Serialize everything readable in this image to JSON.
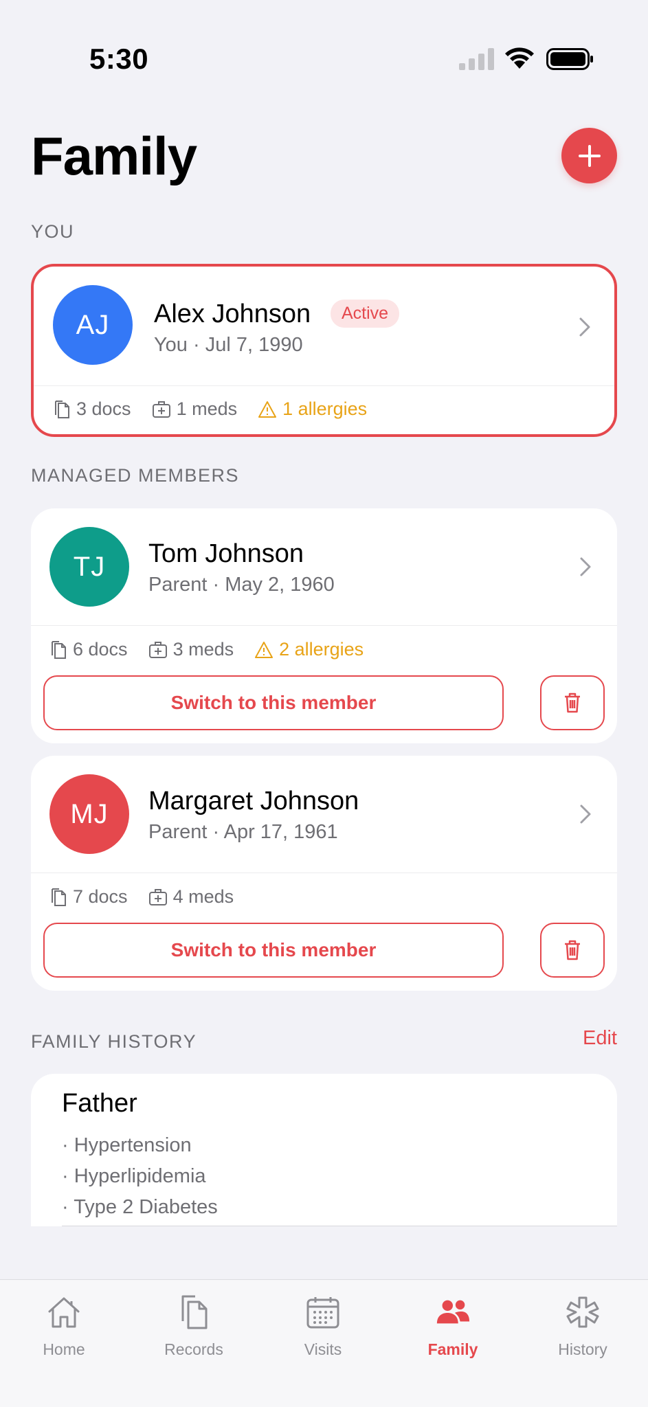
{
  "status_bar": {
    "time": "5:30"
  },
  "header": {
    "title": "Family"
  },
  "sections": {
    "you": "YOU",
    "managed": "MANAGED MEMBERS",
    "history": "FAMILY HISTORY",
    "edit": "Edit"
  },
  "self": {
    "initials": "AJ",
    "name": "Alex Johnson",
    "badge": "Active",
    "subtitle": "You · Jul 7, 1990",
    "docs": "3 docs",
    "meds": "1 meds",
    "allergies": "1 allergies",
    "avatar_color": "#3478F6"
  },
  "members": [
    {
      "initials": "TJ",
      "name": "Tom Johnson",
      "subtitle": "Parent · May 2, 1960",
      "docs": "6 docs",
      "meds": "3 meds",
      "allergies": "2 allergies",
      "switch_label": "Switch to this member",
      "avatar_color": "#0E9D8A"
    },
    {
      "initials": "MJ",
      "name": "Margaret Johnson",
      "subtitle": "Parent · Apr 17, 1961",
      "docs": "7 docs",
      "meds": "4 meds",
      "switch_label": "Switch to this member",
      "avatar_color": "#E5484D"
    }
  ],
  "family_history": {
    "relation": "Father",
    "conditions": [
      "· Hypertension",
      "· Hyperlipidemia",
      "· Type 2 Diabetes"
    ]
  },
  "tabs": [
    {
      "label": "Home",
      "icon": "home-icon"
    },
    {
      "label": "Records",
      "icon": "records-icon"
    },
    {
      "label": "Visits",
      "icon": "calendar-icon"
    },
    {
      "label": "Family",
      "icon": "family-icon",
      "selected": true
    },
    {
      "label": "History",
      "icon": "history-icon"
    }
  ],
  "colors": {
    "accent": "#E5484D",
    "warning": "#E8A317",
    "background": "#F2F2F7"
  }
}
